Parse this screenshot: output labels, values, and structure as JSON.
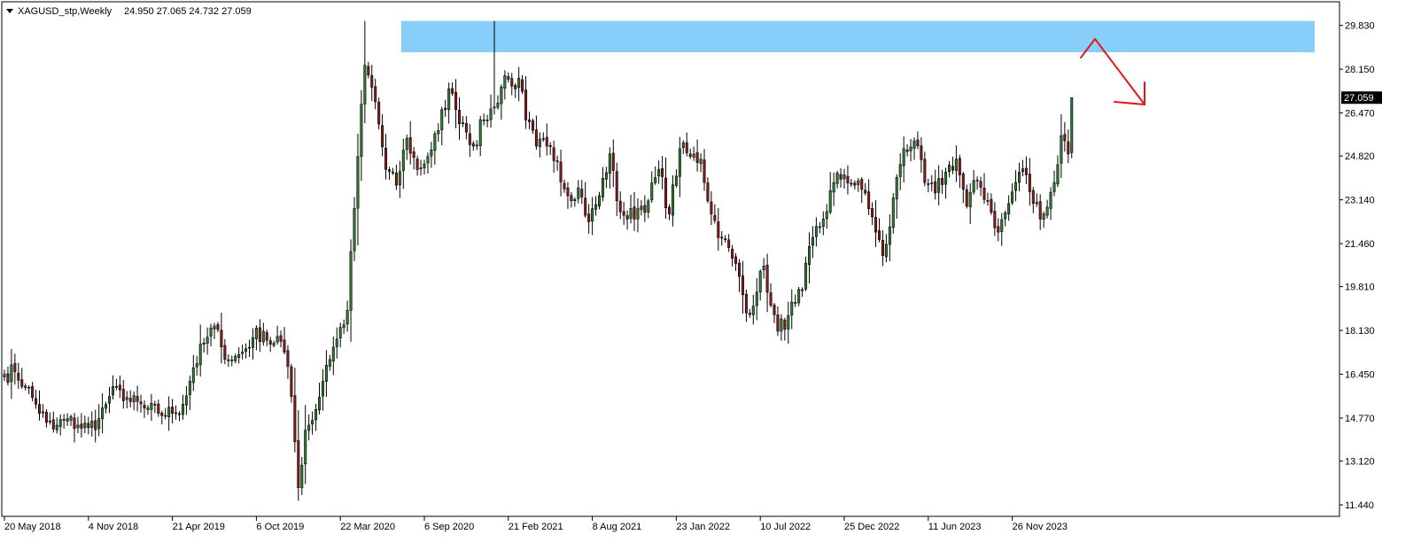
{
  "header": {
    "symbol": "XAGUSD_stp,Weekly",
    "ohlc": "24.950 27.065 24.732 27.059"
  },
  "colors": {
    "bull": "#2e7d32",
    "bear": "#8b1a1a",
    "wick": "#000000",
    "zone": "#87cefa",
    "arrow": "#e8161b",
    "price_label_bg": "#000000",
    "price_label_fg": "#ffffff"
  },
  "chart_data": {
    "type": "candlestick",
    "title": "XAGUSD_stp,Weekly",
    "timeframe": "Weekly",
    "last_price": "27.059",
    "ylim": [
      11.0,
      30.6
    ],
    "y_ticks": [
      "29.830",
      "28.150",
      "26.470",
      "24.820",
      "23.140",
      "21.460",
      "19.810",
      "18.130",
      "16.450",
      "14.770",
      "13.120",
      "11.440"
    ],
    "x_ticks": [
      "20 May 2018",
      "4 Nov 2018",
      "21 Apr 2019",
      "6 Oct 2019",
      "22 Mar 2020",
      "6 Sep 2020",
      "21 Feb 2021",
      "8 Aug 2021",
      "23 Jan 2022",
      "10 Jul 2022",
      "25 Dec 2022",
      "11 Jun 2023",
      "26 Nov 2023"
    ],
    "x_tick_index": [
      0,
      24,
      48,
      72,
      96,
      120,
      144,
      168,
      192,
      216,
      240,
      264,
      288
    ],
    "close_anchors": [
      [
        0,
        16.45
      ],
      [
        3,
        16.55
      ],
      [
        6,
        16.0
      ],
      [
        9,
        15.3
      ],
      [
        12,
        14.6
      ],
      [
        14,
        14.35
      ],
      [
        17,
        14.7
      ],
      [
        21,
        14.5
      ],
      [
        24,
        14.4
      ],
      [
        27,
        14.75
      ],
      [
        30,
        15.6
      ],
      [
        33,
        15.85
      ],
      [
        36,
        15.4
      ],
      [
        40,
        15.15
      ],
      [
        44,
        14.95
      ],
      [
        48,
        14.95
      ],
      [
        51,
        15.3
      ],
      [
        54,
        16.7
      ],
      [
        57,
        17.6
      ],
      [
        60,
        18.3
      ],
      [
        62,
        17.5
      ],
      [
        65,
        17.0
      ],
      [
        68,
        17.3
      ],
      [
        71,
        17.85
      ],
      [
        74,
        18.1
      ],
      [
        76,
        17.6
      ],
      [
        78,
        17.9
      ],
      [
        80,
        17.3
      ],
      [
        82,
        15.6
      ],
      [
        84,
        12.1
      ],
      [
        86,
        14.3
      ],
      [
        89,
        15.1
      ],
      [
        92,
        16.8
      ],
      [
        95,
        17.8
      ],
      [
        98,
        18.9
      ],
      [
        101,
        24.8
      ],
      [
        103,
        28.3
      ],
      [
        106,
        26.9
      ],
      [
        109,
        24.3
      ],
      [
        112,
        23.7
      ],
      [
        115,
        25.5
      ],
      [
        118,
        24.3
      ],
      [
        121,
        24.8
      ],
      [
        124,
        25.8
      ],
      [
        127,
        27.4
      ],
      [
        129,
        26.6
      ],
      [
        131,
        26.1
      ],
      [
        134,
        25.2
      ],
      [
        137,
        26.2
      ],
      [
        140,
        26.7
      ],
      [
        143,
        27.9
      ],
      [
        145,
        27.5
      ],
      [
        147,
        27.8
      ],
      [
        149,
        26.2
      ],
      [
        152,
        25.2
      ],
      [
        155,
        25.2
      ],
      [
        158,
        24.6
      ],
      [
        161,
        23.3
      ],
      [
        164,
        23.6
      ],
      [
        167,
        22.3
      ],
      [
        170,
        23.3
      ],
      [
        173,
        24.9
      ],
      [
        175,
        23.1
      ],
      [
        178,
        22.4
      ],
      [
        181,
        22.8
      ],
      [
        184,
        23.1
      ],
      [
        187,
        24.3
      ],
      [
        190,
        22.6
      ],
      [
        193,
        25.1
      ],
      [
        196,
        24.8
      ],
      [
        199,
        24.7
      ],
      [
        202,
        22.6
      ],
      [
        205,
        21.7
      ],
      [
        208,
        20.9
      ],
      [
        210,
        20.2
      ],
      [
        212,
        18.8
      ],
      [
        215,
        19.6
      ],
      [
        217,
        20.6
      ],
      [
        219,
        19.1
      ],
      [
        221,
        18.1
      ],
      [
        224,
        18.7
      ],
      [
        226,
        19.2
      ],
      [
        228,
        19.7
      ],
      [
        231,
        21.7
      ],
      [
        234,
        22.4
      ],
      [
        237,
        23.8
      ],
      [
        240,
        24.1
      ],
      [
        243,
        23.7
      ],
      [
        246,
        23.4
      ],
      [
        249,
        21.9
      ],
      [
        251,
        21.0
      ],
      [
        253,
        22.1
      ],
      [
        255,
        24.0
      ],
      [
        257,
        25.1
      ],
      [
        260,
        25.4
      ],
      [
        263,
        23.8
      ],
      [
        266,
        23.4
      ],
      [
        269,
        24.2
      ],
      [
        272,
        24.7
      ],
      [
        275,
        22.9
      ],
      [
        278,
        23.9
      ],
      [
        281,
        23.1
      ],
      [
        284,
        21.9
      ],
      [
        287,
        23.0
      ],
      [
        290,
        24.2
      ],
      [
        292,
        24.1
      ],
      [
        294,
        23.0
      ],
      [
        297,
        22.6
      ],
      [
        300,
        23.8
      ],
      [
        302,
        25.6
      ],
      [
        304,
        24.9
      ],
      [
        305,
        27.059
      ]
    ],
    "candle_count": 306,
    "annotations": {
      "resistance_zone": {
        "from_price": 30.0,
        "to_price": 28.8
      },
      "arrow": {
        "direction": "down-right"
      }
    }
  }
}
